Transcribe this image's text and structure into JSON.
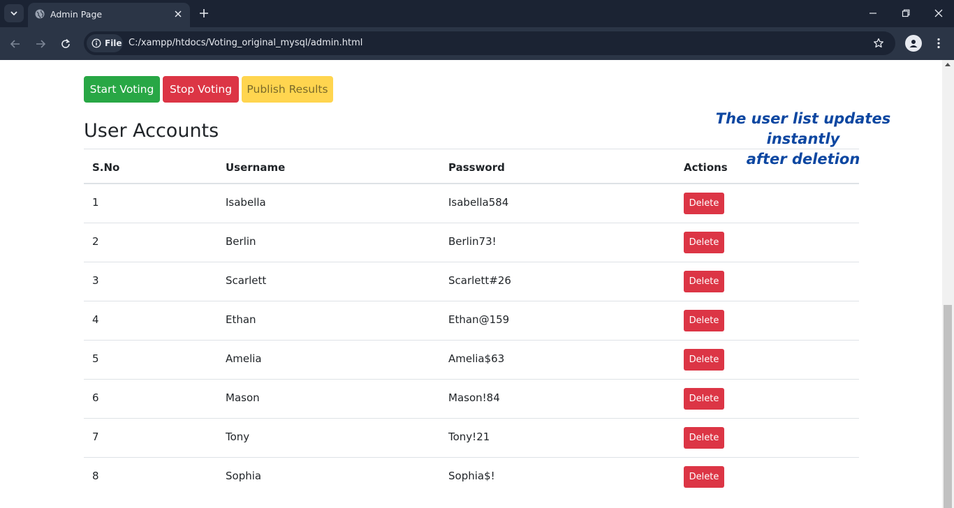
{
  "browser": {
    "tab_title": "Admin Page",
    "url_chip": "File",
    "url": "C:/xampp/htdocs/Voting_original_mysql/admin.html"
  },
  "controls": {
    "start_label": "Start Voting",
    "stop_label": "Stop Voting",
    "publish_label": "Publish Results"
  },
  "page": {
    "heading": "User Accounts",
    "annotation_line1": "The user list updates instantly",
    "annotation_line2": "after deletion"
  },
  "table": {
    "headers": [
      "S.No",
      "Username",
      "Password",
      "Actions"
    ],
    "rows": [
      {
        "sno": "1",
        "username": "Isabella",
        "password": "Isabella584",
        "action": "Delete"
      },
      {
        "sno": "2",
        "username": "Berlin",
        "password": "Berlin73!",
        "action": "Delete"
      },
      {
        "sno": "3",
        "username": "Scarlett",
        "password": "Scarlett#26",
        "action": "Delete"
      },
      {
        "sno": "4",
        "username": "Ethan",
        "password": "Ethan@159",
        "action": "Delete"
      },
      {
        "sno": "5",
        "username": "Amelia",
        "password": "Amelia$63",
        "action": "Delete"
      },
      {
        "sno": "6",
        "username": "Mason",
        "password": "Mason!84",
        "action": "Delete"
      },
      {
        "sno": "7",
        "username": "Tony",
        "password": "Tony!21",
        "action": "Delete"
      },
      {
        "sno": "8",
        "username": "Sophia",
        "password": "Sophia$!",
        "action": "Delete"
      }
    ]
  },
  "colors": {
    "start": "#28a745",
    "stop": "#dc3545",
    "publish": "#ffd54f",
    "annotation": "#0d47a1"
  }
}
